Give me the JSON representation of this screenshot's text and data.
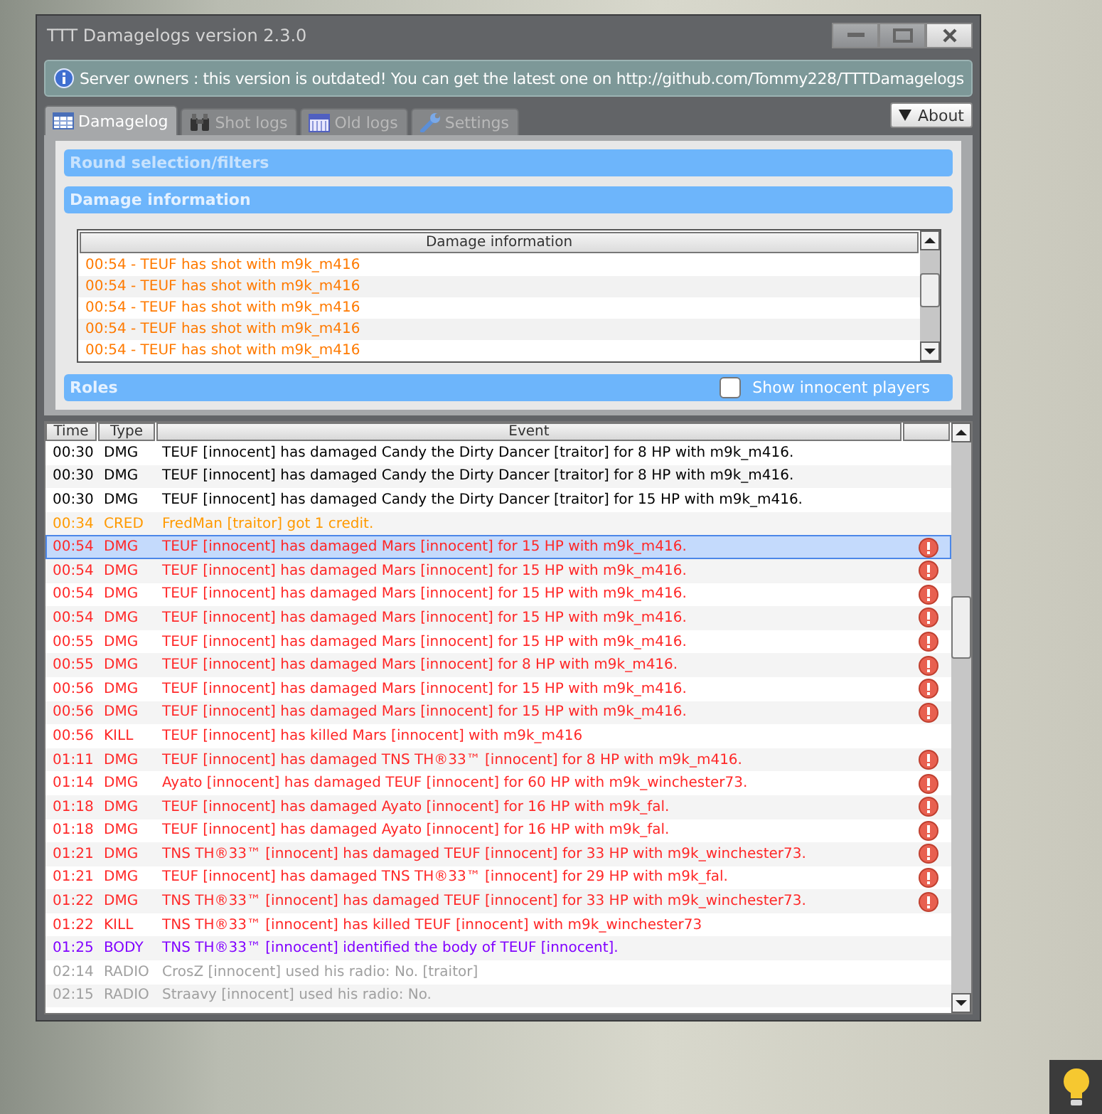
{
  "window": {
    "title": "TTT Damagelogs version 2.3.0"
  },
  "notice": {
    "text": "Server owners : this version is outdated! You can get the latest one on http://github.com/Tommy228/TTTDamagelogs"
  },
  "tabs": [
    {
      "label": "Damagelog",
      "selected": true
    },
    {
      "label": "Shot logs",
      "selected": false
    },
    {
      "label": "Old logs",
      "selected": false
    },
    {
      "label": "Settings",
      "selected": false
    }
  ],
  "about_button": {
    "label": "About"
  },
  "round_filters": {
    "title": "Round selection/filters"
  },
  "damage_information": {
    "title": "Damage information",
    "column": "Damage information",
    "rows": [
      "00:54 - TEUF has shot with m9k_m416",
      "00:54 - TEUF has shot with m9k_m416",
      "00:54 - TEUF has shot with m9k_m416",
      "00:54 - TEUF has shot with m9k_m416",
      "00:54 - TEUF has shot with m9k_m416"
    ]
  },
  "roles": {
    "title": "Roles",
    "checkbox": {
      "label": "Show innocent players",
      "checked": false
    }
  },
  "log_table": {
    "columns": [
      "Time",
      "Type",
      "Event"
    ],
    "rows": [
      {
        "time": "00:30",
        "type": "DMG",
        "event": "TEUF [innocent] has damaged Candy the Dirty Dancer [traitor] for 8 HP with m9k_m416.",
        "color": "#000000",
        "warning": false,
        "selected": false
      },
      {
        "time": "00:30",
        "type": "DMG",
        "event": "TEUF [innocent] has damaged Candy the Dirty Dancer [traitor] for 8 HP with m9k_m416.",
        "color": "#000000",
        "warning": false,
        "selected": false
      },
      {
        "time": "00:30",
        "type": "DMG",
        "event": "TEUF [innocent] has damaged Candy the Dirty Dancer [traitor] for 15 HP with m9k_m416.",
        "color": "#000000",
        "warning": false,
        "selected": false
      },
      {
        "time": "00:34",
        "type": "CRED",
        "event": "FredMan [traitor] got 1 credit.",
        "color": "#ff9a00",
        "warning": false,
        "selected": false
      },
      {
        "time": "00:54",
        "type": "DMG",
        "event": "TEUF [innocent] has damaged Mars [innocent] for 15 HP with m9k_m416.",
        "color": "#ff2828",
        "warning": true,
        "selected": true
      },
      {
        "time": "00:54",
        "type": "DMG",
        "event": "TEUF [innocent] has damaged Mars [innocent] for 15 HP with m9k_m416.",
        "color": "#ff2828",
        "warning": true,
        "selected": false
      },
      {
        "time": "00:54",
        "type": "DMG",
        "event": "TEUF [innocent] has damaged Mars [innocent] for 15 HP with m9k_m416.",
        "color": "#ff2828",
        "warning": true,
        "selected": false
      },
      {
        "time": "00:54",
        "type": "DMG",
        "event": "TEUF [innocent] has damaged Mars [innocent] for 15 HP with m9k_m416.",
        "color": "#ff2828",
        "warning": true,
        "selected": false
      },
      {
        "time": "00:55",
        "type": "DMG",
        "event": "TEUF [innocent] has damaged Mars [innocent] for 15 HP with m9k_m416.",
        "color": "#ff2828",
        "warning": true,
        "selected": false
      },
      {
        "time": "00:55",
        "type": "DMG",
        "event": "TEUF [innocent] has damaged Mars [innocent] for 8 HP with m9k_m416.",
        "color": "#ff2828",
        "warning": true,
        "selected": false
      },
      {
        "time": "00:56",
        "type": "DMG",
        "event": "TEUF [innocent] has damaged Mars [innocent] for 15 HP with m9k_m416.",
        "color": "#ff2828",
        "warning": true,
        "selected": false
      },
      {
        "time": "00:56",
        "type": "DMG",
        "event": "TEUF [innocent] has damaged Mars [innocent] for 15 HP with m9k_m416.",
        "color": "#ff2828",
        "warning": true,
        "selected": false
      },
      {
        "time": "00:56",
        "type": "KILL",
        "event": "TEUF [innocent] has killed Mars [innocent] with m9k_m416",
        "color": "#ff2828",
        "warning": false,
        "selected": false
      },
      {
        "time": "01:11",
        "type": "DMG",
        "event": "TEUF [innocent] has damaged TNS TH®33™ [innocent] for 8 HP with m9k_m416.",
        "color": "#ff2828",
        "warning": true,
        "selected": false
      },
      {
        "time": "01:14",
        "type": "DMG",
        "event": "Ayato [innocent] has damaged TEUF [innocent] for 60 HP with m9k_winchester73.",
        "color": "#ff2828",
        "warning": true,
        "selected": false
      },
      {
        "time": "01:18",
        "type": "DMG",
        "event": "TEUF [innocent] has damaged Ayato [innocent] for 16 HP with m9k_fal.",
        "color": "#ff2828",
        "warning": true,
        "selected": false
      },
      {
        "time": "01:18",
        "type": "DMG",
        "event": "TEUF [innocent] has damaged Ayato [innocent] for 16 HP with m9k_fal.",
        "color": "#ff2828",
        "warning": true,
        "selected": false
      },
      {
        "time": "01:21",
        "type": "DMG",
        "event": "TNS TH®33™ [innocent] has damaged TEUF [innocent] for 33 HP with m9k_winchester73.",
        "color": "#ff2828",
        "warning": true,
        "selected": false
      },
      {
        "time": "01:21",
        "type": "DMG",
        "event": "TEUF [innocent] has damaged TNS TH®33™ [innocent] for 29 HP with m9k_fal.",
        "color": "#ff2828",
        "warning": true,
        "selected": false
      },
      {
        "time": "01:22",
        "type": "DMG",
        "event": "TNS TH®33™ [innocent] has damaged TEUF [innocent] for 33 HP with m9k_winchester73.",
        "color": "#ff2828",
        "warning": true,
        "selected": false
      },
      {
        "time": "01:22",
        "type": "KILL",
        "event": "TNS TH®33™ [innocent] has killed TEUF [innocent] with m9k_winchester73",
        "color": "#ff2828",
        "warning": false,
        "selected": false
      },
      {
        "time": "01:25",
        "type": "BODY",
        "event": "TNS TH®33™ [innocent] identified the body of TEUF [innocent].",
        "color": "#8000ff",
        "warning": false,
        "selected": false
      },
      {
        "time": "02:14",
        "type": "RADIO",
        "event": "CrosZ [innocent] used his radio: No. [traitor]",
        "color": "#a0a0a0",
        "warning": false,
        "selected": false
      },
      {
        "time": "02:15",
        "type": "RADIO",
        "event": "Straavy [innocent] used his radio: No.",
        "color": "#a0a0a0",
        "warning": false,
        "selected": false
      }
    ]
  }
}
